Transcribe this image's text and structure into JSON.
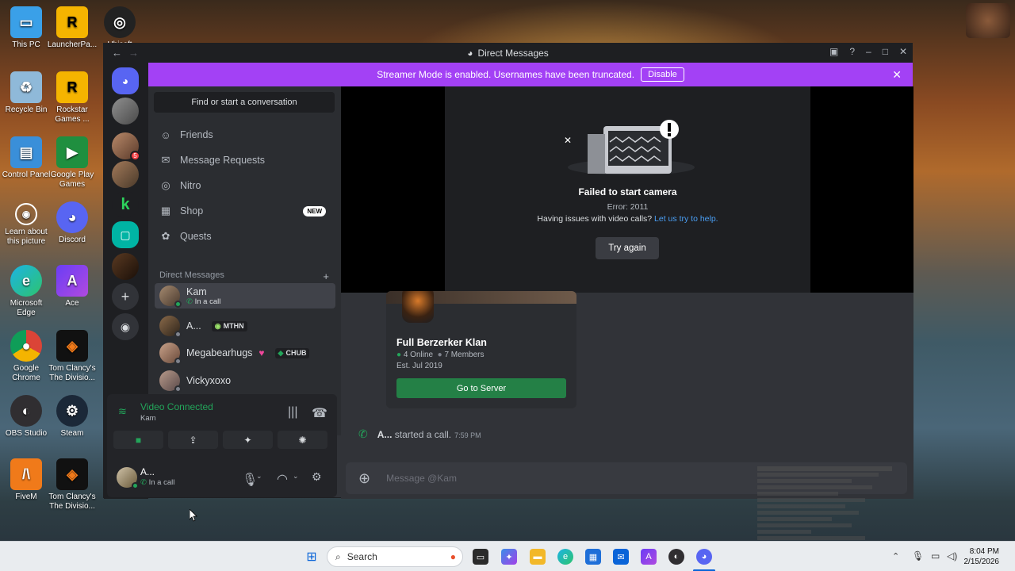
{
  "desktop": {
    "icons": [
      {
        "label": "This PC"
      },
      {
        "label": "LauncherPa..."
      },
      {
        "label": "Ubisoft"
      },
      {
        "label": "Recycle Bin"
      },
      {
        "label": "Rockstar Games ..."
      },
      {
        "label": "Control Panel"
      },
      {
        "label": "Google Play Games"
      },
      {
        "label": "Learn about this picture"
      },
      {
        "label": "Discord"
      },
      {
        "label": "Microsoft Edge"
      },
      {
        "label": "Ace"
      },
      {
        "label": "Google Chrome"
      },
      {
        "label": "Tom Clancy's The Divisio..."
      },
      {
        "label": "OBS Studio"
      },
      {
        "label": "Steam"
      },
      {
        "label": "FiveM"
      },
      {
        "label": "Tom Clancy's The Divisio..."
      }
    ]
  },
  "window": {
    "title": "Direct Messages",
    "banner": {
      "text": "Streamer Mode is enabled. Usernames have been truncated.",
      "button": "Disable"
    }
  },
  "servers": {
    "badge": "5"
  },
  "sidebar": {
    "search": "Find or start a conversation",
    "nav": [
      {
        "label": "Friends",
        "icon": "friends-icon"
      },
      {
        "label": "Message Requests",
        "icon": "mail-icon"
      },
      {
        "label": "Nitro",
        "icon": "nitro-icon"
      },
      {
        "label": "Shop",
        "icon": "shop-icon",
        "badge": "NEW"
      },
      {
        "label": "Quests",
        "icon": "quests-icon"
      }
    ],
    "dm_header": "Direct Messages",
    "dms": [
      {
        "name": "Kam",
        "sub": "In a call"
      },
      {
        "name": "A...",
        "tag": "MTHN"
      },
      {
        "name": "Megabearhugs",
        "tag": "CHUB"
      },
      {
        "name": "Vickyxoxo"
      }
    ]
  },
  "voice": {
    "status": "Video Connected",
    "channel": "Kam"
  },
  "user": {
    "name": "A...",
    "status": "In a call"
  },
  "camera_error": {
    "title": "Failed to start camera",
    "code": "Error: 2011",
    "help_text": "Having issues with video calls?",
    "help_link": "Let us try to help.",
    "retry": "Try again"
  },
  "invite": {
    "name": "Full Berzerker Klan",
    "online": "4 Online",
    "members": "7 Members",
    "established": "Est. Jul 2019",
    "button": "Go to Server"
  },
  "call_message": {
    "user": "A...",
    "text": "started a call.",
    "time": "7:59 PM"
  },
  "composer": {
    "placeholder": "Message @Kam"
  },
  "taskbar": {
    "search": "Search",
    "time": "8:04 PM",
    "date": "2/15/2026"
  },
  "colors": {
    "accent": "#5865f2",
    "banner": "#a341f5",
    "green": "#23a55a",
    "button_green": "#248046"
  }
}
